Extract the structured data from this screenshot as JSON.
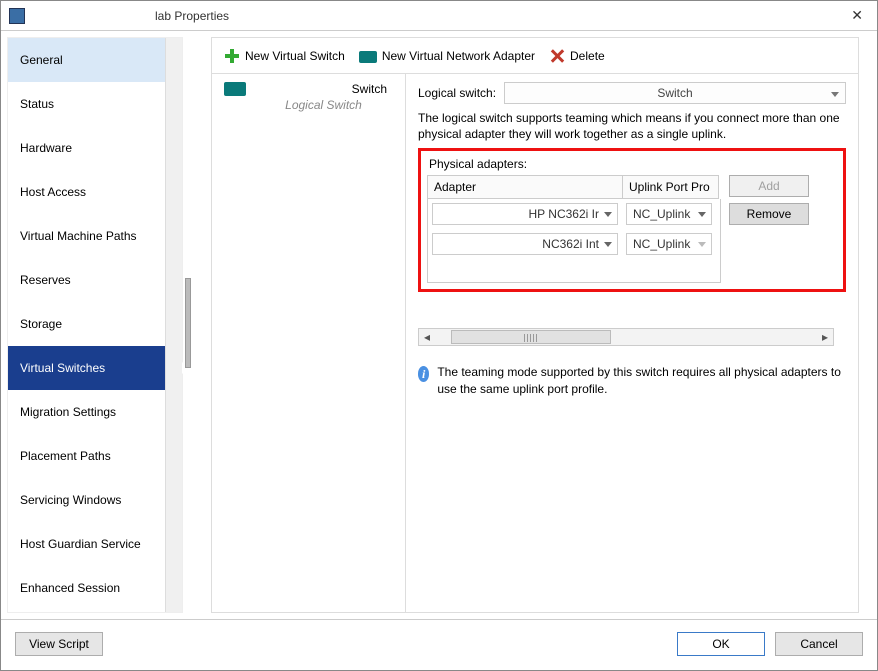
{
  "titlebar": {
    "title": "lab Properties"
  },
  "nav": {
    "items": [
      "General",
      "Status",
      "Hardware",
      "Host Access",
      "Virtual Machine Paths",
      "Reserves",
      "Storage",
      "Virtual Switches",
      "Migration Settings",
      "Placement Paths",
      "Servicing Windows",
      "Host Guardian Service",
      "Enhanced Session"
    ],
    "highlighted": 0,
    "selected": 7
  },
  "toolbar": {
    "new_switch": "New Virtual Switch",
    "new_adapter": "New Virtual Network Adapter",
    "delete": "Delete"
  },
  "switch_list": {
    "entries": [
      {
        "name": "Switch",
        "subtitle": "Logical Switch"
      }
    ]
  },
  "detail": {
    "logical_switch_label": "Logical switch:",
    "logical_switch_value": "Switch",
    "help": "The logical switch supports teaming which means if you connect more than one physical adapter they will work together as a single uplink.",
    "pa_label": "Physical adapters:",
    "columns": {
      "adapter": "Adapter",
      "uplink": "Uplink Port Pro"
    },
    "rows": [
      {
        "adapter": "HP NC362i Ir",
        "uplink": "NC_Uplink"
      },
      {
        "adapter": "NC362i Int",
        "uplink": "NC_Uplink"
      }
    ],
    "buttons": {
      "add": "Add",
      "remove": "Remove"
    },
    "info": "The teaming mode supported by this switch requires all physical adapters to use the same uplink port profile."
  },
  "footer": {
    "view_script": "View Script",
    "ok": "OK",
    "cancel": "Cancel"
  }
}
